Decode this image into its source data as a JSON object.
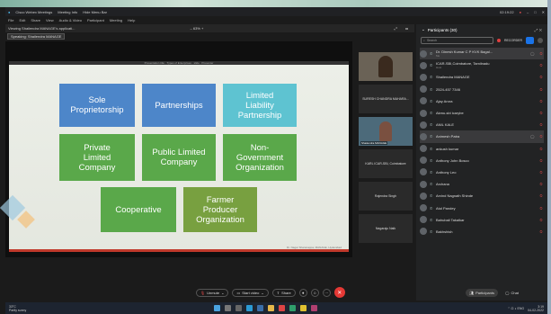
{
  "window": {
    "title": "Cisco Webex Meetings",
    "tabs": [
      "Meeting Info",
      "Hide Menu Bar"
    ],
    "timer": "02:19:22",
    "menu": [
      "File",
      "Edit",
      "Share",
      "View",
      "Audio & Video",
      "Participant",
      "Meeting",
      "Help"
    ]
  },
  "share": {
    "viewing_text": "Viewing Shailendra MANAGE's applicati...",
    "zoom": "63%",
    "speaking": "Speaking: Shailendra MANAGE"
  },
  "slide": {
    "header": "Presentation title  ·  Types of Enterprises  ·  slide  ·  Presenter",
    "footer": "Dr. Nagar Sharanappa, MANAGE, Hyderabad",
    "boxes": [
      {
        "text": "Sole Proprietorship"
      },
      {
        "text": "Partnerships"
      },
      {
        "text": "Limited Liability Partnership"
      },
      {
        "text": "Private Limited Company"
      },
      {
        "text": "Public Limited Company"
      },
      {
        "text": "Non-Government Organization"
      },
      {
        "text": "Cooperative"
      },
      {
        "text": "Farmer Producer Organization"
      }
    ]
  },
  "videos": [
    {
      "name": "",
      "label": ""
    },
    {
      "name": "SURESH CHANDRA MAHARA...",
      "label": ""
    },
    {
      "name": "",
      "label": "Shailendra MANAGE"
    },
    {
      "name": "KARL ICAR-SBI, Coimbatore",
      "label": ""
    },
    {
      "name": "Rajendra Singh",
      "label": ""
    },
    {
      "name": "Nagaraju Naik",
      "label": ""
    }
  ],
  "panel": {
    "title": "Participants (30)",
    "search_placeholder": "Search",
    "recorder": "RECORDER",
    "participants": [
      {
        "name": "Dr. Dinesh Kumar C P KVK Bagal...",
        "sub": "Me",
        "sel": true
      },
      {
        "name": "ICAR-SBI,Coimbatore, Tamilnadu",
        "sub": "Host"
      },
      {
        "name": "Shailendra MANAGE",
        "sub": ""
      },
      {
        "name": "2524-457 7346",
        "sub": ""
      },
      {
        "name": "Ajay Arora",
        "sub": ""
      },
      {
        "name": "Akmu-sbi icarybe",
        "sub": ""
      },
      {
        "name": "ANIL KALE",
        "sub": ""
      },
      {
        "name": "Animesh Patra",
        "sub": "",
        "sel": true
      },
      {
        "name": "ankush kumar",
        "sub": ""
      },
      {
        "name": "Anthony John Bosco",
        "sub": ""
      },
      {
        "name": "Anthony Leo",
        "sub": ""
      },
      {
        "name": "Archana",
        "sub": ""
      },
      {
        "name": "Arvind Nagnath Shinde",
        "sub": ""
      },
      {
        "name": "Atul Pandey",
        "sub": ""
      },
      {
        "name": "Bahubali Takalkar",
        "sub": ""
      },
      {
        "name": "Bakhshish",
        "sub": ""
      }
    ]
  },
  "controls": {
    "unmute": "Unmute",
    "start_video": "Start video",
    "share": "Share",
    "participants": "Participants",
    "chat": "Chat"
  },
  "taskbar": {
    "weather_temp": "33°C",
    "weather_desc": "Partly sunny",
    "time": "3:19",
    "date": "04-02-2022"
  }
}
